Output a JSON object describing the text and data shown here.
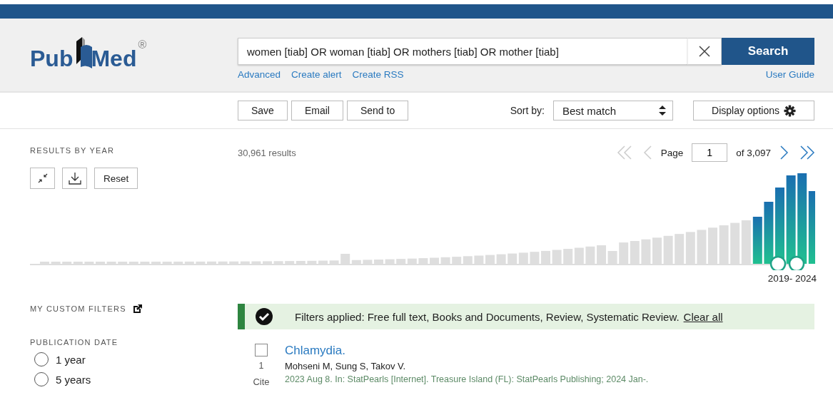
{
  "header": {
    "logo_left": "Pub",
    "logo_right": "Med",
    "registered": "®",
    "search_value": "women [tiab] OR woman [tiab] OR mothers [tiab] OR mother [tiab]",
    "search_button": "Search",
    "links": [
      "Advanced",
      "Create alert",
      "Create RSS"
    ],
    "user_guide": "User Guide"
  },
  "toolbar": {
    "actions": [
      "Save",
      "Email",
      "Send to"
    ],
    "sort_label": "Sort by:",
    "sort_value": "Best match",
    "display_options": "Display options"
  },
  "results_by_year": {
    "title": "RESULTS BY YEAR",
    "reset": "Reset",
    "range_label": "2019- 2024"
  },
  "results": {
    "count": "30,961 results",
    "page_label": "Page",
    "page": "1",
    "page_total": "of 3,097"
  },
  "filters": {
    "custom_title": "MY CUSTOM FILTERS",
    "publication_date_title": "PUBLICATION DATE",
    "date_options": [
      {
        "label": "1 year",
        "selected": false
      },
      {
        "label": "5 years",
        "selected": false
      }
    ]
  },
  "banner": {
    "text": "Filters applied: Free full text, Books and Documents, Review, Systematic Review.",
    "link": "Clear all"
  },
  "articles": [
    {
      "checked": false,
      "number": "1",
      "cite": "Cite",
      "title": "Chlamydia.",
      "authors": "Mohseni M, Sung S, Takov V.",
      "citation": "2023 Aug 8. In: StatPearls [Internet]. Treasure Island (FL): StatPearls Publishing; 2024 Jan-."
    }
  ]
}
